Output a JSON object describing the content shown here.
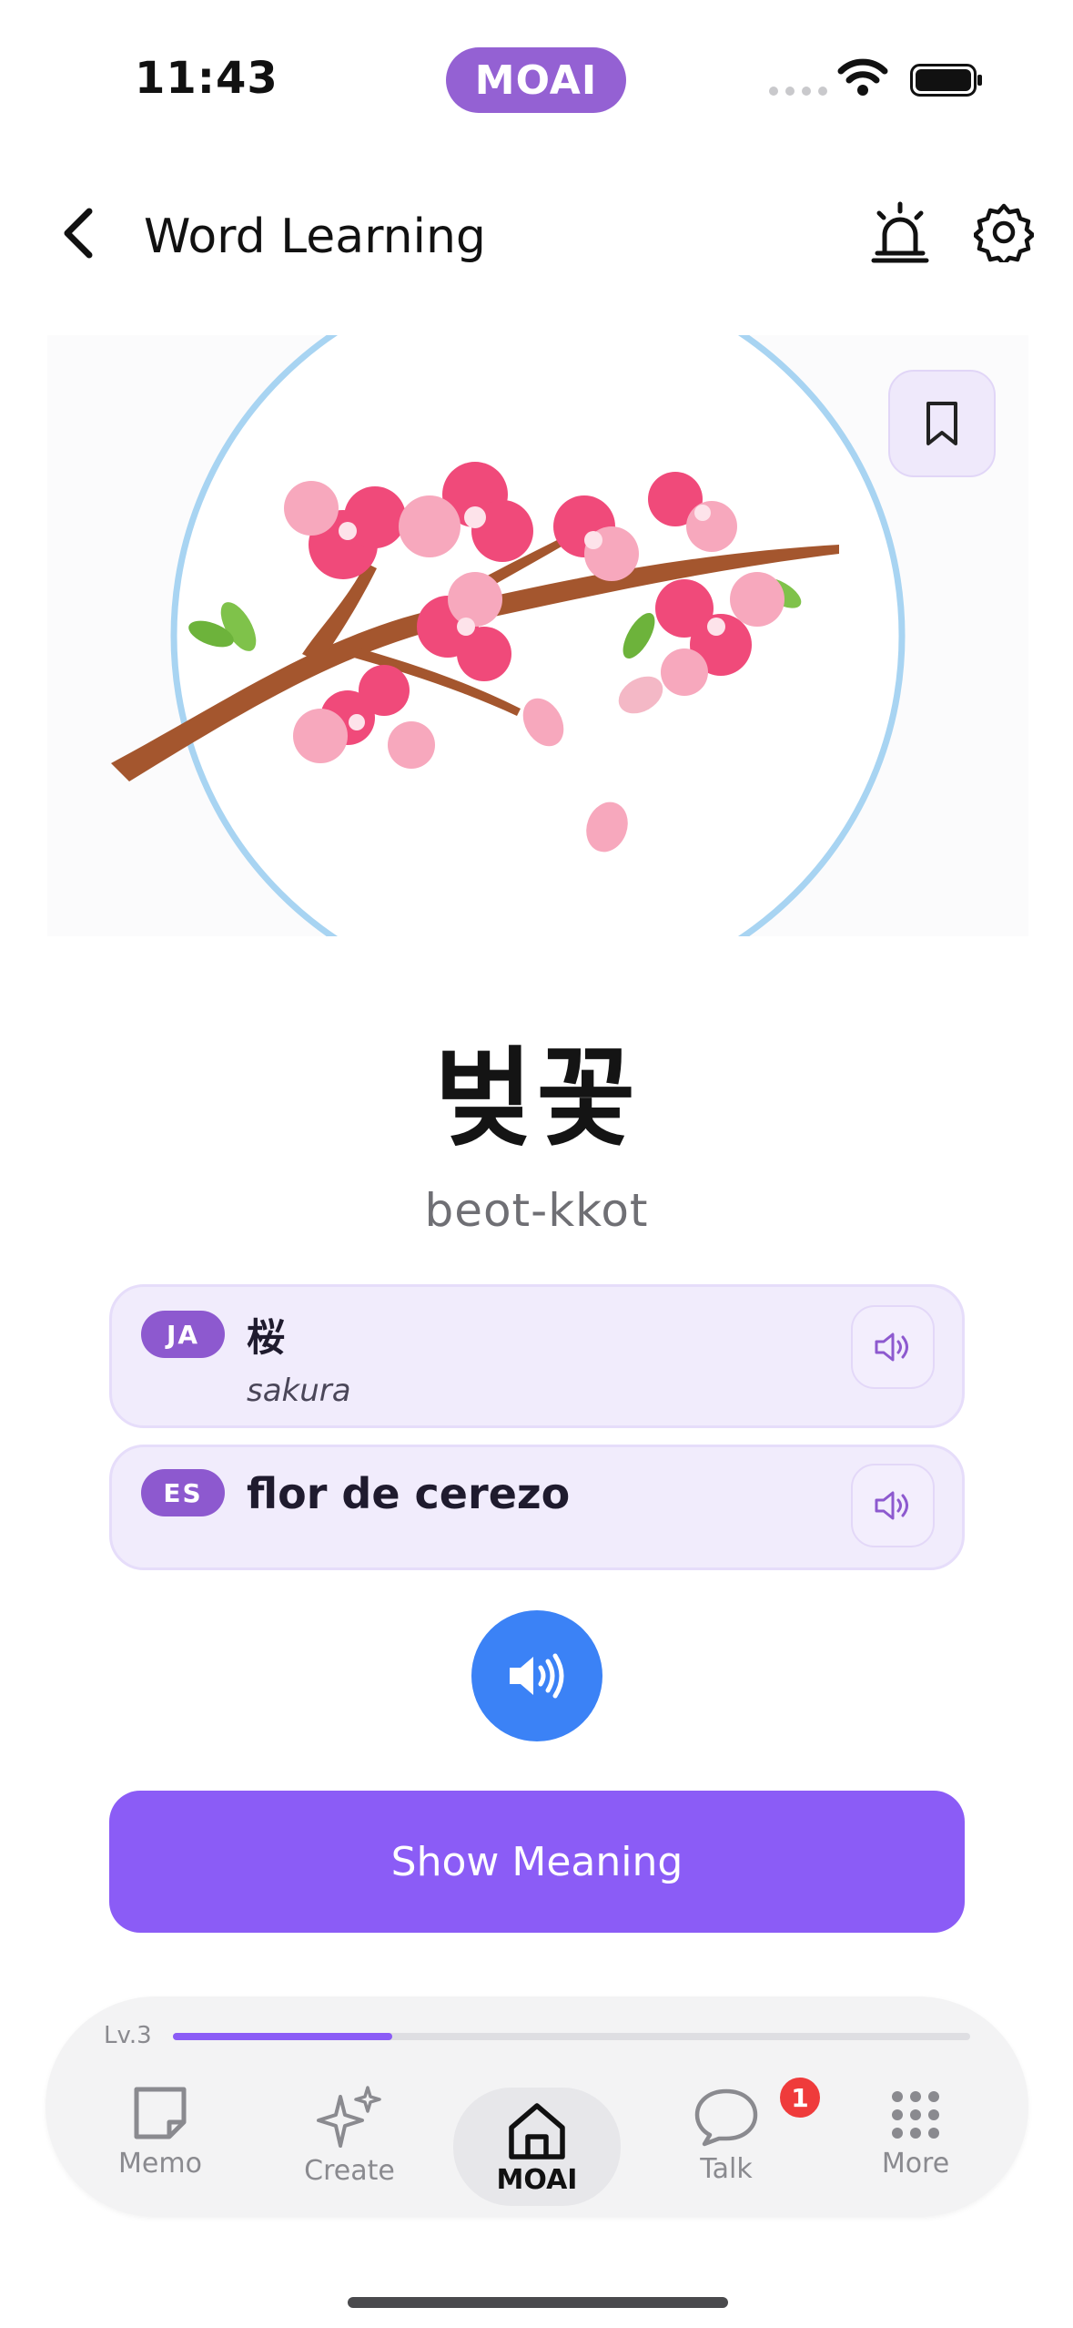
{
  "status_bar": {
    "time": "11:43",
    "app_pill": "MOAI"
  },
  "header": {
    "title": "Word Learning"
  },
  "word": {
    "text": "벚꽃",
    "romanization": "beot-kkot"
  },
  "translations": [
    {
      "lang": "JA",
      "word": "桜",
      "reading": "sakura"
    },
    {
      "lang": "ES",
      "word": "flor de cerezo"
    }
  ],
  "actions": {
    "show_meaning": "Show Meaning"
  },
  "progress": {
    "level": "Lv.3",
    "fraction": 0.275
  },
  "nav": [
    {
      "label": "Memo",
      "icon": "memo-icon"
    },
    {
      "label": "Create",
      "icon": "sparkle-icon"
    },
    {
      "label": "MOAI",
      "icon": "home-icon",
      "active": true
    },
    {
      "label": "Talk",
      "icon": "chat-icon",
      "badge": "1"
    },
    {
      "label": "More",
      "icon": "grid-icon"
    }
  ],
  "colors": {
    "accent": "#8b5cf6",
    "play": "#3b82f6",
    "lang_badge": "#8d59cf",
    "notification": "#ef3b3b"
  }
}
